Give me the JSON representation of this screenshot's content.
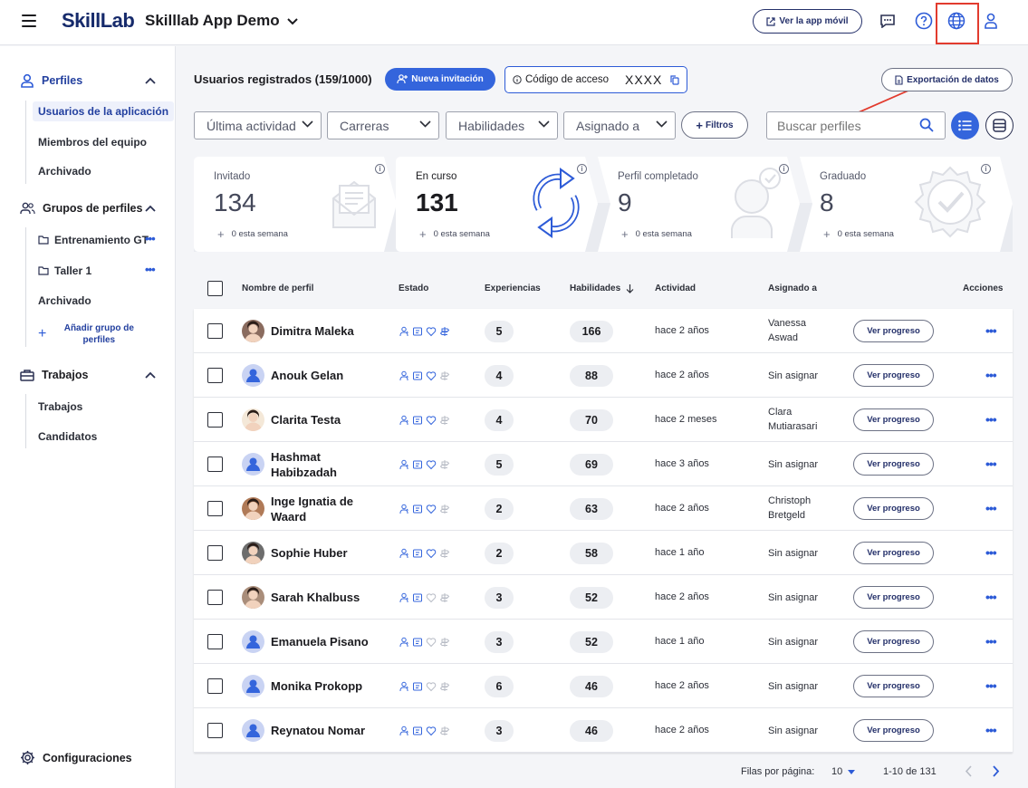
{
  "header": {
    "logo": "SkillLab",
    "app_title": "Skilllab App Demo",
    "mobile_button": "Ver la app móvil"
  },
  "sidebar": {
    "profiles": {
      "title": "Perfiles",
      "items": [
        "Usuarios de la aplicación",
        "Miembros del equipo",
        "Archivado"
      ]
    },
    "groups": {
      "title": "Grupos de perfiles",
      "items": [
        "Entrenamiento GT",
        "Taller 1",
        "Archivado"
      ],
      "add_label": "Añadir grupo de perfiles"
    },
    "jobs": {
      "title": "Trabajos",
      "items": [
        "Trabajos",
        "Candidatos"
      ]
    },
    "settings": "Configuraciones"
  },
  "toolbar": {
    "title": "Usuarios registrados (159/1000)",
    "invite_button": "Nueva invitación",
    "code_label": "Código de acceso",
    "code_value": "XXXX",
    "export_button": "Exportación de datos"
  },
  "filters": {
    "last_activity": "Última actividad",
    "careers": "Carreras",
    "skills": "Habilidades",
    "assigned_to": "Asignado a",
    "filters_button": "Filtros",
    "search_placeholder": "Buscar perfiles"
  },
  "stats": [
    {
      "label": "Invitado",
      "value": "134",
      "week": "0 esta semana"
    },
    {
      "label": "En curso",
      "value": "131",
      "week": "0 esta semana"
    },
    {
      "label": "Perfil completado",
      "value": "9",
      "week": "0 esta semana"
    },
    {
      "label": "Graduado",
      "value": "8",
      "week": "0 esta semana"
    }
  ],
  "table": {
    "columns": [
      "Nombre de perfil",
      "Estado",
      "Experiencias",
      "Habilidades",
      "Actividad",
      "Asignado a",
      "Acciones"
    ],
    "progress_button": "Ver progreso",
    "rows": [
      {
        "name": "Dimitra Maleka",
        "exp": "5",
        "skills": "166",
        "activity": "hace 2 años",
        "assigned": "Vanessa Aswad",
        "status": 4
      },
      {
        "name": "Anouk Gelan",
        "exp": "4",
        "skills": "88",
        "activity": "hace 2 años",
        "assigned": "Sin asignar",
        "status": 3
      },
      {
        "name": "Clarita Testa",
        "exp": "4",
        "skills": "70",
        "activity": "hace 2 meses",
        "assigned": "Clara Mutiarasari",
        "status": 3
      },
      {
        "name": "Hashmat Habibzadah",
        "exp": "5",
        "skills": "69",
        "activity": "hace 3 años",
        "assigned": "Sin asignar",
        "status": 3
      },
      {
        "name": "Inge Ignatia de Waard",
        "exp": "2",
        "skills": "63",
        "activity": "hace 2 años",
        "assigned": "Christoph Bretgeld",
        "status": 3
      },
      {
        "name": "Sophie Huber",
        "exp": "2",
        "skills": "58",
        "activity": "hace 1 año",
        "assigned": "Sin asignar",
        "status": 3
      },
      {
        "name": "Sarah Khalbuss",
        "exp": "3",
        "skills": "52",
        "activity": "hace 2 años",
        "assigned": "Sin asignar",
        "status": 2
      },
      {
        "name": "Emanuela Pisano",
        "exp": "3",
        "skills": "52",
        "activity": "hace 1 año",
        "assigned": "Sin asignar",
        "status": 2
      },
      {
        "name": "Monika Prokopp",
        "exp": "6",
        "skills": "46",
        "activity": "hace 2 años",
        "assigned": "Sin asignar",
        "status": 2
      },
      {
        "name": "Reynatou Nomar",
        "exp": "3",
        "skills": "46",
        "activity": "hace 2 años",
        "assigned": "Sin asignar",
        "status": 3
      }
    ]
  },
  "pagination": {
    "rows_label": "Filas por página:",
    "rows_value": "10",
    "range": "1-10 de 131"
  },
  "colors": {
    "accent": "#3465dc",
    "highlight": "#e23b2e"
  }
}
